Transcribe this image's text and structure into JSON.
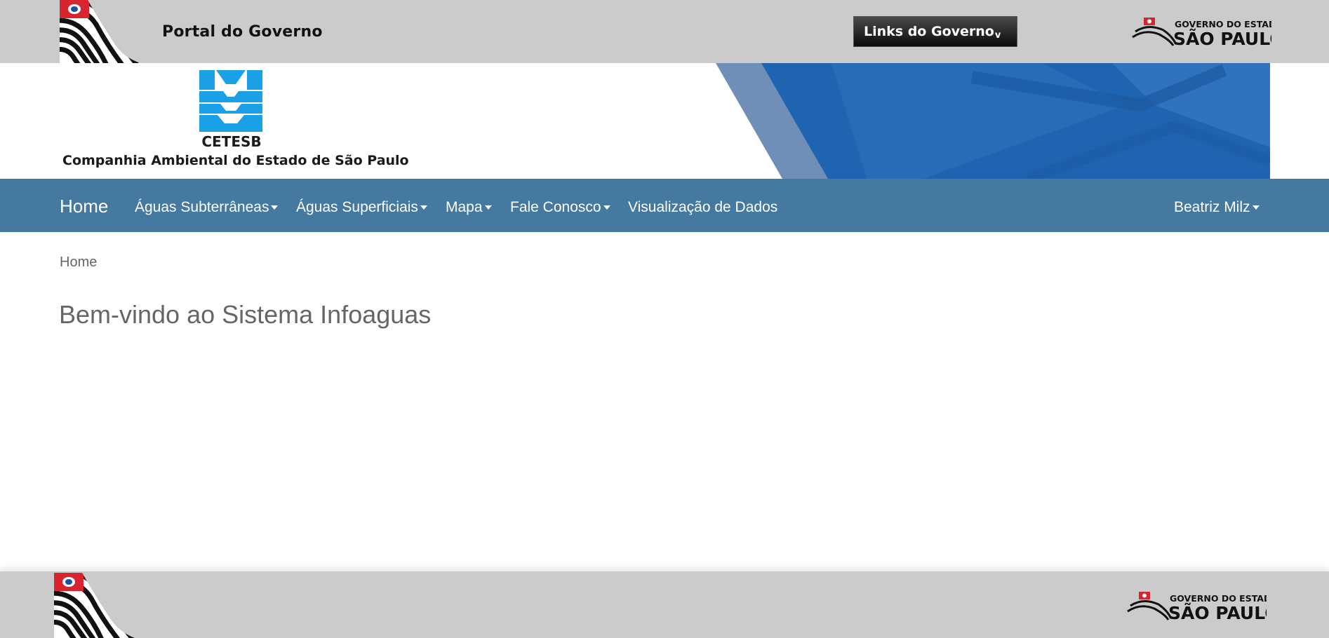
{
  "gov_bar": {
    "portal_label": "Portal do Governo",
    "links_label": "Links do Governo",
    "links_caret": "v",
    "logo_top_text": "GOVERNO DO ESTADO",
    "logo_main_text": "SÃO PAULO"
  },
  "header": {
    "org_short": "CETESB",
    "org_full": "Companhia Ambiental do Estado de São Paulo"
  },
  "navbar": {
    "home": "Home",
    "items": [
      {
        "label": "Águas Subterrâneas"
      },
      {
        "label": "Águas Superficiais"
      },
      {
        "label": "Mapa"
      },
      {
        "label": "Fale Conosco"
      },
      {
        "label": "Visualização de Dados"
      }
    ],
    "user": "Beatriz Milz"
  },
  "breadcrumb": "Home",
  "page_title": "Bem-vindo ao Sistema Infoaguas",
  "footer": {
    "logo_top_text": "GOVERNO DO ESTADO",
    "logo_main_text": "SÃO PAULO"
  },
  "colors": {
    "gov_bar_bg": "#cbcbcb",
    "navbar_bg": "#4579a0",
    "banner_blue": "#1e64b0",
    "cetesb_blue": "#1aa0e6",
    "text_gray": "#666666"
  },
  "icons": {
    "flag": "sao-paulo-flag-icon",
    "gov_logo": "governo-sao-paulo-logo",
    "cetesb": "cetesb-logo-icon",
    "caret": "caret-down-icon"
  }
}
